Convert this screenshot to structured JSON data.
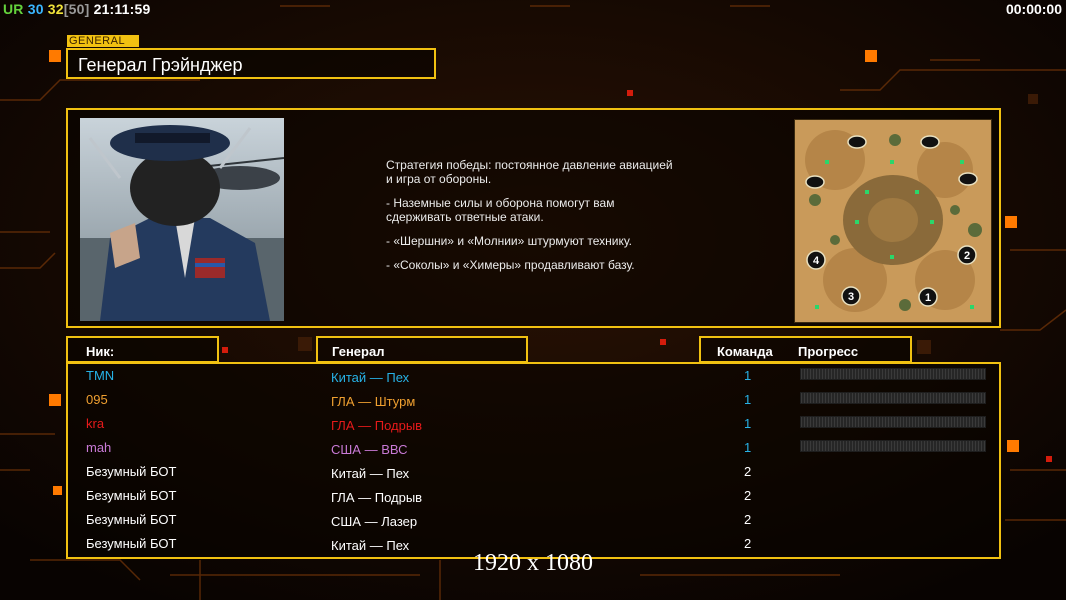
{
  "hud": {
    "version": "UR",
    "value_a": "30",
    "value_b": "32",
    "value_c": "[50]",
    "clock": "21:11:59",
    "timer": "00:00:00"
  },
  "general_tag": "GENERAL",
  "general_name": "Генерал Грэйнджер",
  "strategy": [
    "Стратегия победы: постоянное давление авиацией\n и игра от обороны.",
    "- Наземные силы и оборона помогут вам\n сдерживать ответные атаки.",
    "- «Шершни» и «Молнии» штурмуют технику.",
    "- «Соколы» и «Химеры» продавливают базу."
  ],
  "map_spawns": [
    "4",
    "2",
    "3",
    "1"
  ],
  "table_headers": {
    "nick": "Ник:",
    "general": "Генерал",
    "team": "Команда",
    "progress": "Прогресс"
  },
  "players": [
    {
      "nick": "TMN",
      "general": "Китай — Пех",
      "team": "1",
      "color": "#27b2e6",
      "progress": 0
    },
    {
      "nick": "095",
      "general": "ГЛА — Штурм",
      "team": "1",
      "color": "#f0a030",
      "progress": 0
    },
    {
      "nick": "kra",
      "general": "ГЛА — Подрыв",
      "team": "1",
      "color": "#e61a1a",
      "progress": 0
    },
    {
      "nick": "mah",
      "general": "США — ВВС",
      "team": "1",
      "color": "#c97ad6",
      "progress": 0
    },
    {
      "nick": "Безумный БОТ",
      "general": "Китай — Пех",
      "team": "2",
      "color": "#ffffff"
    },
    {
      "nick": "Безумный БОТ",
      "general": "ГЛА — Подрыв",
      "team": "2",
      "color": "#ffffff"
    },
    {
      "nick": "Безумный БОТ",
      "general": "США — Лазер",
      "team": "2",
      "color": "#ffffff"
    },
    {
      "nick": "Безумный БОТ",
      "general": "Китай — Пех",
      "team": "2",
      "color": "#ffffff"
    }
  ],
  "watermark": "1920 x 1080",
  "colors": {
    "accent": "#f1c111",
    "team_number": "#27b2e6"
  }
}
